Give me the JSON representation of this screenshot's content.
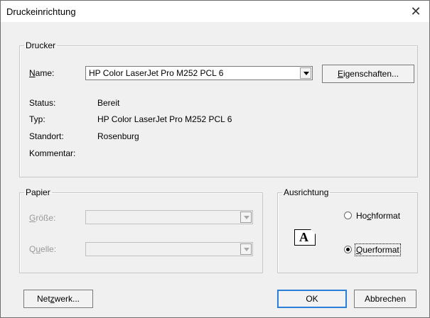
{
  "window": {
    "title": "Druckeinrichtung",
    "close_glyph": "✕"
  },
  "printer": {
    "group_label": "Drucker",
    "name_label": "Name:",
    "name_value": "HP Color LaserJet Pro M252 PCL 6",
    "properties_button": "Eigenschaften...",
    "status_label": "Status:",
    "status_value": "Bereit",
    "type_label": "Typ:",
    "type_value": "HP Color LaserJet Pro M252 PCL 6",
    "location_label": "Standort:",
    "location_value": "Rosenburg",
    "comment_label": "Kommentar:",
    "comment_value": ""
  },
  "paper": {
    "group_label": "Papier",
    "size_label": "Größe:",
    "size_value": "",
    "source_label": "Quelle:",
    "source_value": ""
  },
  "orientation": {
    "group_label": "Ausrichtung",
    "portrait_label": "Hochformat",
    "landscape_label": "Querformat",
    "selected": "landscape",
    "icon_letter": "A"
  },
  "buttons": {
    "network": "Netzwerk...",
    "ok": "OK",
    "cancel": "Abbrechen"
  },
  "colors": {
    "titlebar": "#ffffff",
    "dialog_bg": "#f0f0f0",
    "default_button_border": "#2b7fd8"
  }
}
